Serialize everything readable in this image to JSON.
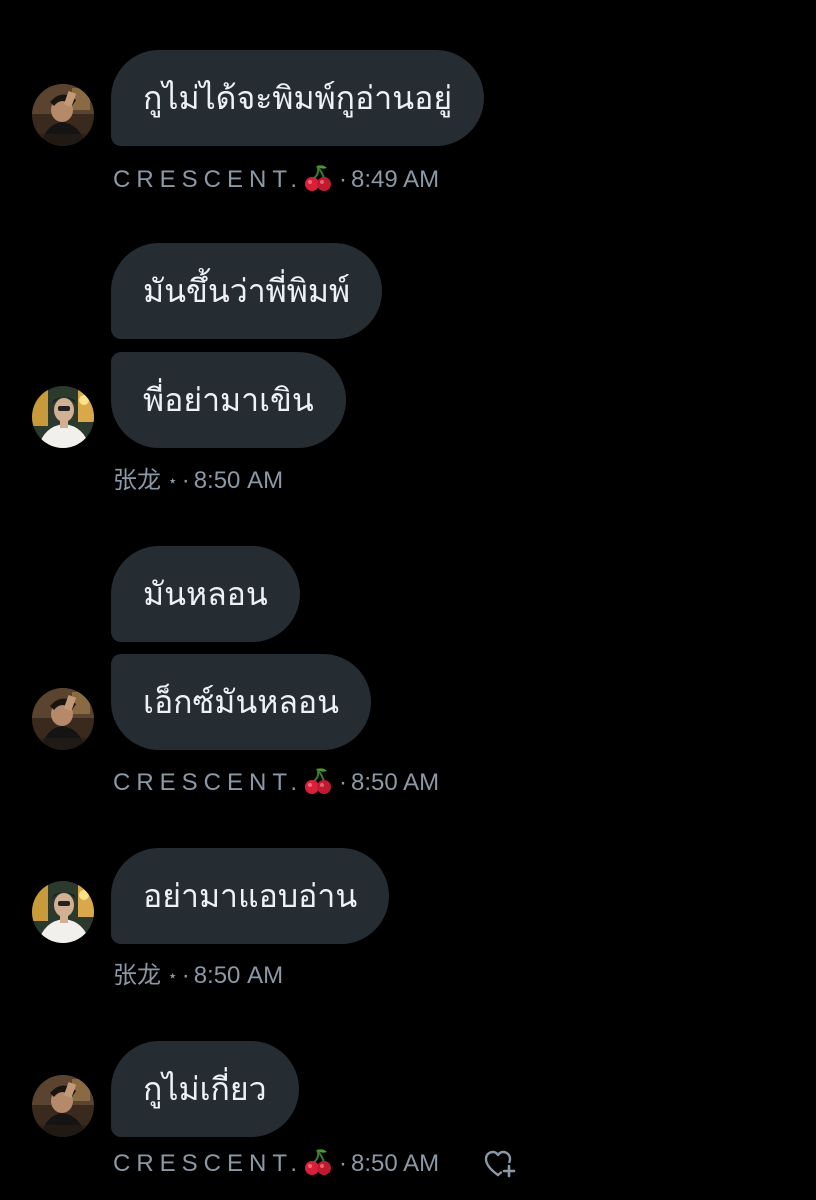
{
  "colors": {
    "background": "#000000",
    "bubble": "#252d33",
    "bubble_text": "#eef1f4",
    "meta_text": "#8b98a5"
  },
  "users": {
    "crescent": {
      "name": "CRESCENT.",
      "emoji_icon": "cherry-icon",
      "avatar": "avatar-crescent"
    },
    "zhanglong": {
      "name": "张龙",
      "emoji_icon": "star-icon",
      "avatar": "avatar-zhanglong"
    }
  },
  "messages": [
    {
      "sender": "crescent",
      "text": "กูไม่ได้จะพิมพ์กูอ่านอยู่"
    },
    {
      "sender": "zhanglong",
      "text": "มันขึ้นว่าพี่พิมพ์"
    },
    {
      "sender": "zhanglong",
      "text": "พี่อย่ามาเขิน"
    },
    {
      "sender": "crescent",
      "text": "มันหลอน"
    },
    {
      "sender": "crescent",
      "text": "เอ็กซ์มันหลอน"
    },
    {
      "sender": "zhanglong",
      "text": "อย่ามาแอบอ่าน"
    },
    {
      "sender": "crescent",
      "text": "กูไม่เกี่ยว"
    }
  ],
  "meta": {
    "m1": {
      "name": "CRESCENT.",
      "dot": "·",
      "time": "8:49 AM"
    },
    "m2": {
      "name": "张龙",
      "star": "⋆",
      "dot": "·",
      "time": "8:50 AM"
    },
    "m3": {
      "name": "CRESCENT.",
      "dot": "·",
      "time": "8:50 AM"
    },
    "m4": {
      "name": "张龙",
      "star": "⋆",
      "dot": "·",
      "time": "8:50 AM"
    },
    "m5": {
      "name": "CRESCENT.",
      "dot": "·",
      "time": "8:50 AM",
      "reaction_icon": "heart-plus-icon"
    }
  }
}
